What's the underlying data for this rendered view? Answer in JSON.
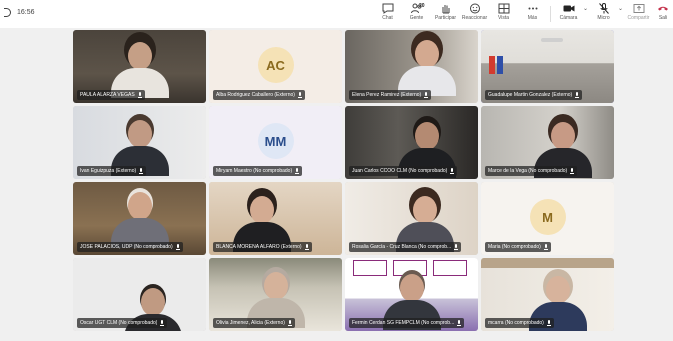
{
  "header": {
    "time": "16:56"
  },
  "toolbar": {
    "buttons": [
      {
        "label": "Chat",
        "icon": "chat-icon"
      },
      {
        "label": "Gente",
        "icon": "people-icon",
        "badge": "20"
      },
      {
        "label": "Participar",
        "icon": "raise-hand-icon"
      },
      {
        "label": "Reaccionar",
        "icon": "react-icon"
      },
      {
        "label": "Vista",
        "icon": "view-icon"
      },
      {
        "label": "Más",
        "icon": "more-icon"
      },
      {
        "label": "Cámara",
        "icon": "camera-icon"
      },
      {
        "label": "Micro",
        "icon": "mic-icon"
      },
      {
        "label": "Compartir",
        "icon": "share-icon"
      },
      {
        "label": "Sali",
        "icon": "leave-icon"
      }
    ]
  },
  "participants": [
    {
      "name": "PAULA ALARZA VEGAS",
      "type": "video"
    },
    {
      "name": "Alba Rodriguez Caballero (Externo)",
      "type": "avatar",
      "initials": "AC"
    },
    {
      "name": "Elena Perez Ramirez (Externo)",
      "type": "video"
    },
    {
      "name": "Guadalupe Martin Gonzalez (Externo)",
      "type": "video",
      "active": true
    },
    {
      "name": "Ivan Eguizpuza (Externo)",
      "type": "video"
    },
    {
      "name": "Miryam Maestro (No comprobado)",
      "type": "avatar",
      "initials": "MM"
    },
    {
      "name": "Juan Carlos CCOO CLM (No comprobado)",
      "type": "video"
    },
    {
      "name": "Marce de la Vega (No comprobado)",
      "type": "video"
    },
    {
      "name": "JOSE PALACIOS, UDP (No comprobado)",
      "type": "video"
    },
    {
      "name": "BLANCA MORENA ALFARO (Externo)",
      "type": "video"
    },
    {
      "name": "Rosalia García - Cruz Blanca (No comprob...",
      "type": "video"
    },
    {
      "name": "Maria (No comprobado)",
      "type": "avatar",
      "initials": "M"
    },
    {
      "name": "Oscar UGT CLM (No comprobado)",
      "type": "video"
    },
    {
      "name": "Olivia Jimenez, Alicia (Externo)",
      "type": "video"
    },
    {
      "name": "Fermin Cerdan SG FEMPCLM (No comprob...",
      "type": "video"
    },
    {
      "name": "mcarra (No comprobado)",
      "type": "video"
    }
  ],
  "colors": {
    "accent": "#7b83eb",
    "stage_bg": "#f0f0f0",
    "avatar_bg": "#f5e2b6",
    "avatar_fg": "#8a6a1e",
    "avatar_bg_mm": "#dfe7f5",
    "avatar_fg_mm": "#2b4e8c",
    "leave_red": "#c4314b"
  }
}
